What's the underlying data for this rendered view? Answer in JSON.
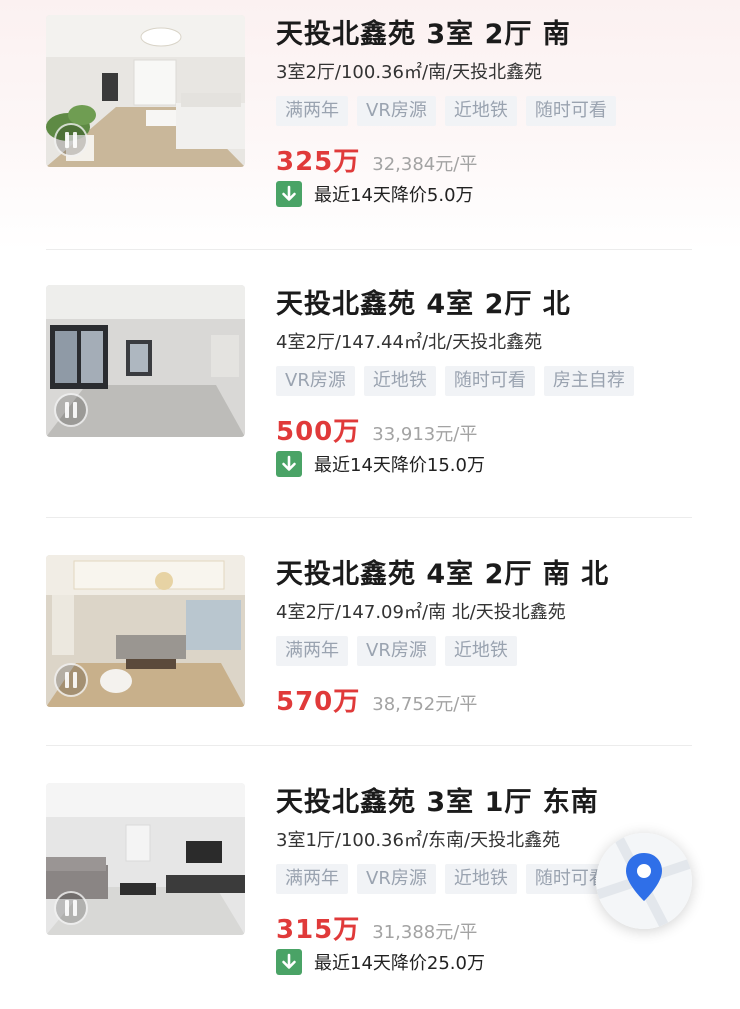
{
  "listings": [
    {
      "title": "天投北鑫苑 3室 2厅 南",
      "subtitle": "3室2厅/100.36㎡/南/天投北鑫苑",
      "tags": [
        "满两年",
        "VR房源",
        "近地铁",
        "随时可看"
      ],
      "price": "325万",
      "unit_price": "32,384元/平",
      "price_drop": "最近14天降价5.0万"
    },
    {
      "title": "天投北鑫苑 4室 2厅 北",
      "subtitle": "4室2厅/147.44㎡/北/天投北鑫苑",
      "tags": [
        "VR房源",
        "近地铁",
        "随时可看",
        "房主自荐"
      ],
      "price": "500万",
      "unit_price": "33,913元/平",
      "price_drop": "最近14天降价15.0万"
    },
    {
      "title": "天投北鑫苑 4室 2厅 南 北",
      "subtitle": "4室2厅/147.09㎡/南 北/天投北鑫苑",
      "tags": [
        "满两年",
        "VR房源",
        "近地铁"
      ],
      "price": "570万",
      "unit_price": "38,752元/平"
    },
    {
      "title": "天投北鑫苑 3室 1厅 东南",
      "subtitle": "3室1厅/100.36㎡/东南/天投北鑫苑",
      "tags": [
        "满两年",
        "VR房源",
        "近地铁",
        "随时可看"
      ],
      "price": "315万",
      "unit_price": "31,388元/平",
      "price_drop": "最近14天降价25.0万"
    }
  ],
  "icons": {
    "price_drop": "arrow-down-icon",
    "vr_badge": "vr-icon",
    "map": "map-pin-icon"
  },
  "colors": {
    "price": "#e03a3a",
    "drop_badge": "#4aa366",
    "tag_bg": "#f1f3f6",
    "tag_text": "#9aa3b0",
    "map_pin": "#2f6fe8"
  }
}
